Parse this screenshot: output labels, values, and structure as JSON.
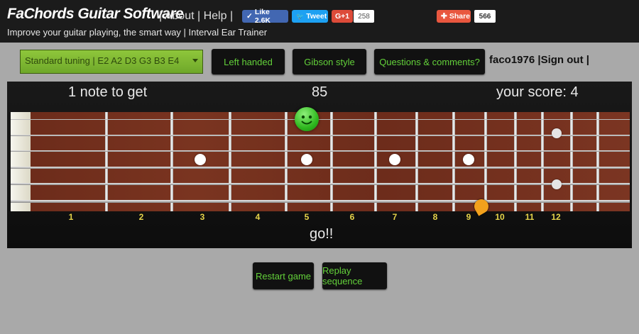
{
  "header": {
    "brand": "FaChords Guitar Software",
    "links": {
      "sep1": "|",
      "about": "About",
      "sep2": "|",
      "help": "Help",
      "sep3": "|"
    },
    "tagline": "Improve your guitar playing, the smart way | Interval Ear Trainer",
    "social": {
      "like_label": "Like 2.6K",
      "tweet_label": "Tweet",
      "gplus_label": "G+1",
      "gplus_count": "258",
      "share_label": "Share",
      "share_count": "566"
    }
  },
  "toolbar": {
    "tuning": "Standard tuning | E2 A2 D3 G3 B3 E4",
    "left_handed": "Left handed",
    "gibson": "Gibson style",
    "questions": "Questions & comments?",
    "user": "faco1976 |Sign out |"
  },
  "game": {
    "notes_to_get": "1 note to get",
    "timer": "85",
    "score": "your score: 4",
    "status": "go!!",
    "fret_numbers": [
      "1",
      "2",
      "3",
      "4",
      "5",
      "6",
      "7",
      "8",
      "9",
      "10",
      "11",
      "12"
    ],
    "restart": "Restart game",
    "replay": "Replay sequence"
  },
  "colors": {
    "accent_green": "#63d13a",
    "tuning_green": "#7fb733",
    "fret_number_yellow": "#e6d44a",
    "background_gray": "#a9a9a9"
  }
}
